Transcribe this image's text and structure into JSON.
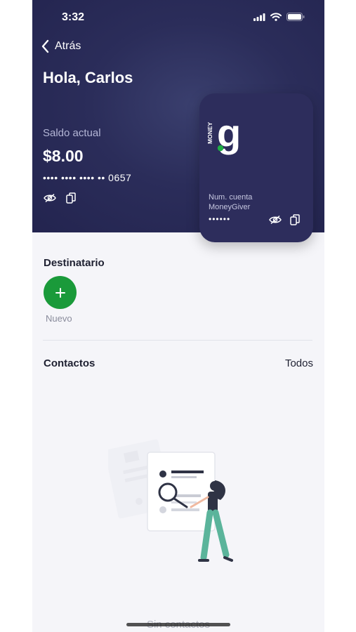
{
  "status_bar": {
    "time": "3:32"
  },
  "header": {
    "back_label": "Atrás",
    "greeting": "Hola, Carlos",
    "balance_label": "Saldo actual",
    "balance_amount": "$8.00",
    "masked_account": "•••• •••• •••• •• 0657"
  },
  "card": {
    "brand_small": "MONEY",
    "brand_letter": "g",
    "label_line1": "Num. cuenta",
    "label_line2": "MoneyGiver",
    "masked_number": "••••••"
  },
  "recipient": {
    "title": "Destinatario",
    "new_label": "Nuevo"
  },
  "contacts": {
    "title": "Contactos",
    "all_label": "Todos",
    "empty_text": "Sin contactos"
  },
  "colors": {
    "header_bg": "#2b2d5a",
    "card_bg": "#2d2d5c",
    "accent_green": "#1a9a3a",
    "page_bg": "#f5f5f9"
  }
}
